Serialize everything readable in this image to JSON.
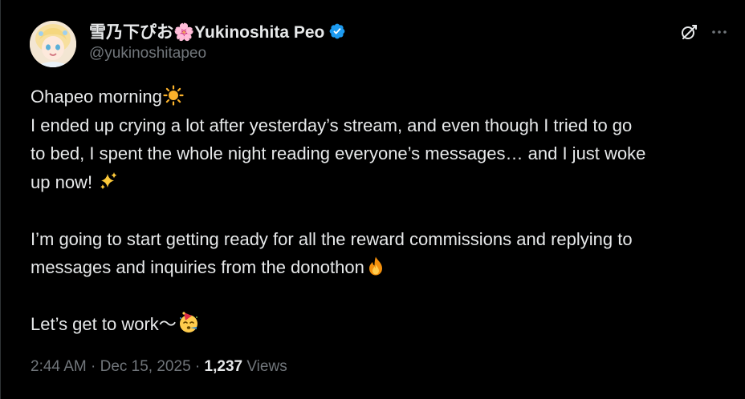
{
  "author": {
    "display_name_jp": "雪乃下ぴお",
    "flower_emoji": "🌸",
    "display_name_en": "Yukinoshita Peo",
    "handle": "@yukinoshitapeo",
    "verified_icon": "verified-badge-icon",
    "avatar_icon": "avatar-image"
  },
  "actions": {
    "grok_icon": "grok-icon",
    "more_icon": "more-icon"
  },
  "tweet": {
    "line1": "Ohapeo morning",
    "line2": "I ended up crying a lot after yesterday’s stream, and even though I tried to go",
    "line3": "to bed, I spent the whole night reading everyone’s messages… and I just woke",
    "line4": "up now! ",
    "line5": "I’m going to start getting ready for all the reward commissions and replying to",
    "line6": "messages and inquiries from the donothon",
    "line7": "Let’s get to work〜"
  },
  "meta": {
    "time": "2:44 AM",
    "sep1": " · ",
    "date": "Dec 15, 2025",
    "sep2": " · ",
    "views_count": "1,237",
    "views_label": " Views"
  },
  "colors": {
    "background": "#000000",
    "text": "#e7e9ea",
    "muted": "#71767b",
    "verified": "#1d9bf0"
  }
}
